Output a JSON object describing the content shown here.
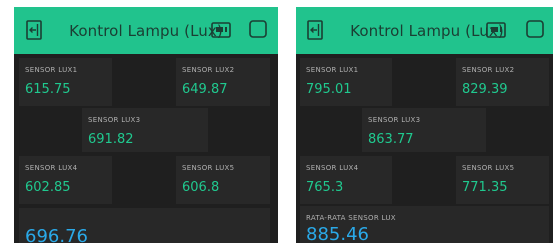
{
  "colors": {
    "header_bg": "#21c38d",
    "panel_bg": "#282828",
    "screen_bg": "#1f1f1f",
    "value_green": "#20c98f",
    "value_blue": "#2aa9e8",
    "label_gray": "#b0b0b0"
  },
  "left": {
    "title": "Kontrol Lampu (Lux)",
    "icons": [
      "back-icon",
      "device-icon",
      "checkbox-icon"
    ],
    "lux1": {
      "label": "SENSOR LUX1",
      "value": "615.75"
    },
    "lux2": {
      "label": "SENSOR LUX2",
      "value": "649.87"
    },
    "lux3": {
      "label": "SENSOR LUX3",
      "value": "691.82"
    },
    "lux4": {
      "label": "SENSOR LUX4",
      "value": "602.85"
    },
    "lux5": {
      "label": "SENSOR LUX5",
      "value": "606.8"
    },
    "avg": {
      "value": "696.76"
    }
  },
  "right": {
    "title": "Kontrol Lampu (Lux)",
    "icons": [
      "back-icon",
      "device-icon",
      "checkbox-icon"
    ],
    "lux1": {
      "label": "SENSOR LUX1",
      "value": "795.01"
    },
    "lux2": {
      "label": "SENSOR LUX2",
      "value": "829.39"
    },
    "lux3": {
      "label": "SENSOR LUX3",
      "value": "863.77"
    },
    "lux4": {
      "label": "SENSOR LUX4",
      "value": "765.3"
    },
    "lux5": {
      "label": "SENSOR LUX5",
      "value": "771.35"
    },
    "avg": {
      "label": "RATA-RATA SENSOR LUX",
      "value": "885.46"
    }
  }
}
